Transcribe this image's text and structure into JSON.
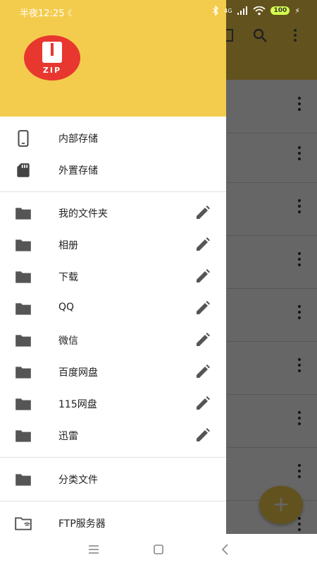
{
  "status_bar": {
    "time": "半夜12:25",
    "signal_label": "4G",
    "battery": "100"
  },
  "drawer": {
    "logo_text": "ZIP",
    "storage": [
      {
        "label": "内部存储",
        "icon": "phone-icon"
      },
      {
        "label": "外置存储",
        "icon": "sd-card-icon"
      }
    ],
    "folders": [
      {
        "label": "我的文件夹"
      },
      {
        "label": "相册"
      },
      {
        "label": "下载"
      },
      {
        "label": "QQ"
      },
      {
        "label": "微信"
      },
      {
        "label": "百度网盘"
      },
      {
        "label": "115网盘"
      },
      {
        "label": "迅雷"
      }
    ],
    "category": {
      "label": "分类文件"
    },
    "ftp": {
      "label": "FTP服务器"
    }
  },
  "fab": {
    "symbol": "+"
  },
  "colors": {
    "accent": "#f4cc4d",
    "logo_red": "#e8372f",
    "icon_gray": "#555555"
  }
}
